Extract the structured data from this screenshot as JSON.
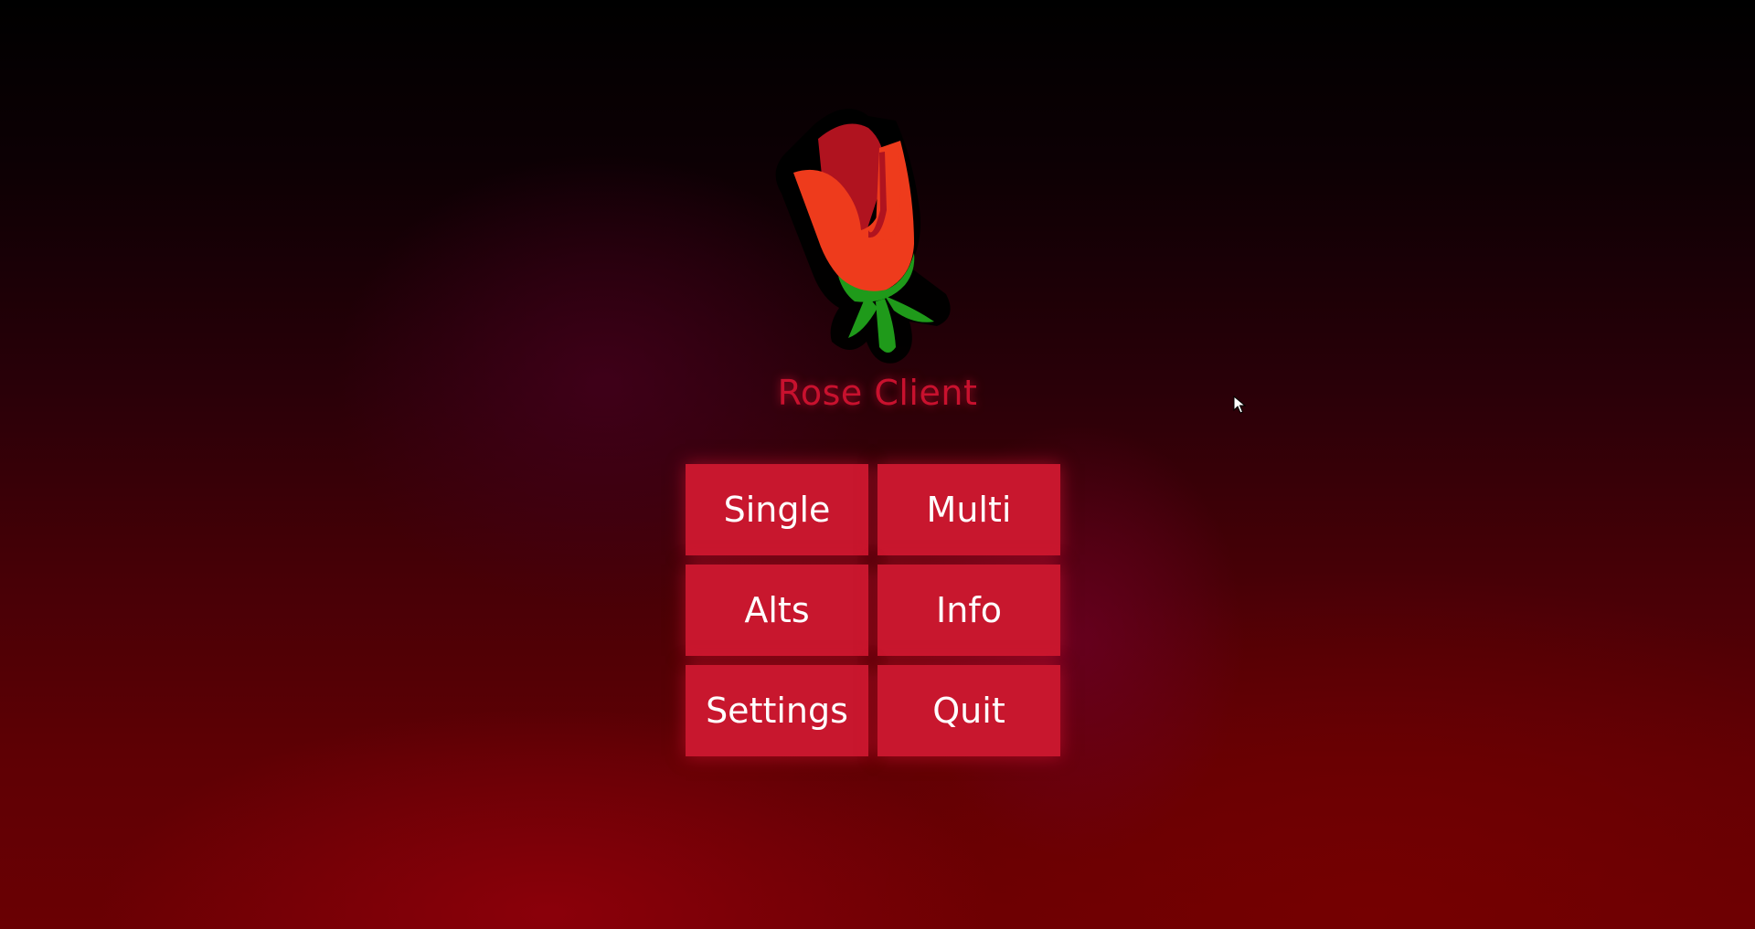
{
  "app": {
    "title": "Rose Client",
    "logo_icon": "rose-icon"
  },
  "menu": {
    "buttons": [
      {
        "id": "single",
        "label": "Single"
      },
      {
        "id": "multi",
        "label": "Multi"
      },
      {
        "id": "alts",
        "label": "Alts"
      },
      {
        "id": "info",
        "label": "Info"
      },
      {
        "id": "settings",
        "label": "Settings"
      },
      {
        "id": "quit",
        "label": "Quit"
      }
    ]
  },
  "colors": {
    "accent": "#c8172e",
    "title": "#c8112e",
    "button_text": "#ffffff",
    "petal": "#ee3b1c",
    "petal_dark": "#b0131f",
    "leaf": "#1f9a1a"
  },
  "cursor_icon": "mouse-pointer-icon"
}
